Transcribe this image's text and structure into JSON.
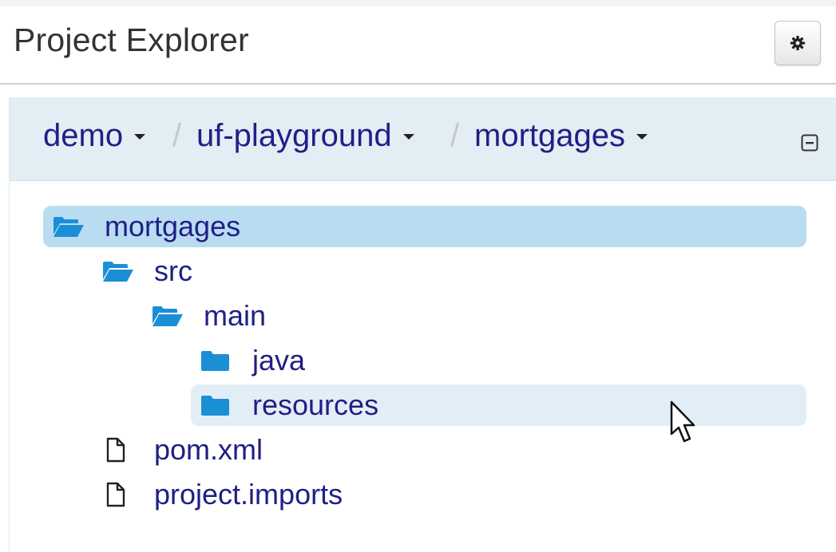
{
  "header": {
    "title": "Project Explorer",
    "settings_icon": "gear-icon"
  },
  "breadcrumb": {
    "items": [
      {
        "label": "demo"
      },
      {
        "label": "uf-playground"
      },
      {
        "label": "mortgages"
      }
    ],
    "separator": "/",
    "collapse_icon": "collapse-minus-icon"
  },
  "tree": {
    "items": [
      {
        "label": "mortgages",
        "type": "folder-open",
        "depth": 0,
        "state": "selected"
      },
      {
        "label": "src",
        "type": "folder-open",
        "depth": 1
      },
      {
        "label": "main",
        "type": "folder-open",
        "depth": 2
      },
      {
        "label": "java",
        "type": "folder",
        "depth": 3
      },
      {
        "label": "resources",
        "type": "folder",
        "depth": 3,
        "state": "hover"
      },
      {
        "label": "pom.xml",
        "type": "file",
        "depth": 1
      },
      {
        "label": "project.imports",
        "type": "file",
        "depth": 1
      }
    ]
  },
  "colors": {
    "link_text": "#1f1f86",
    "folder_icon": "#1a8fd6",
    "selected_row": "#b9dcf0",
    "hover_row": "#e2eef6",
    "breadcrumb_bar": "#e3edf4"
  },
  "cursor_icon": "mouse-pointer-icon"
}
